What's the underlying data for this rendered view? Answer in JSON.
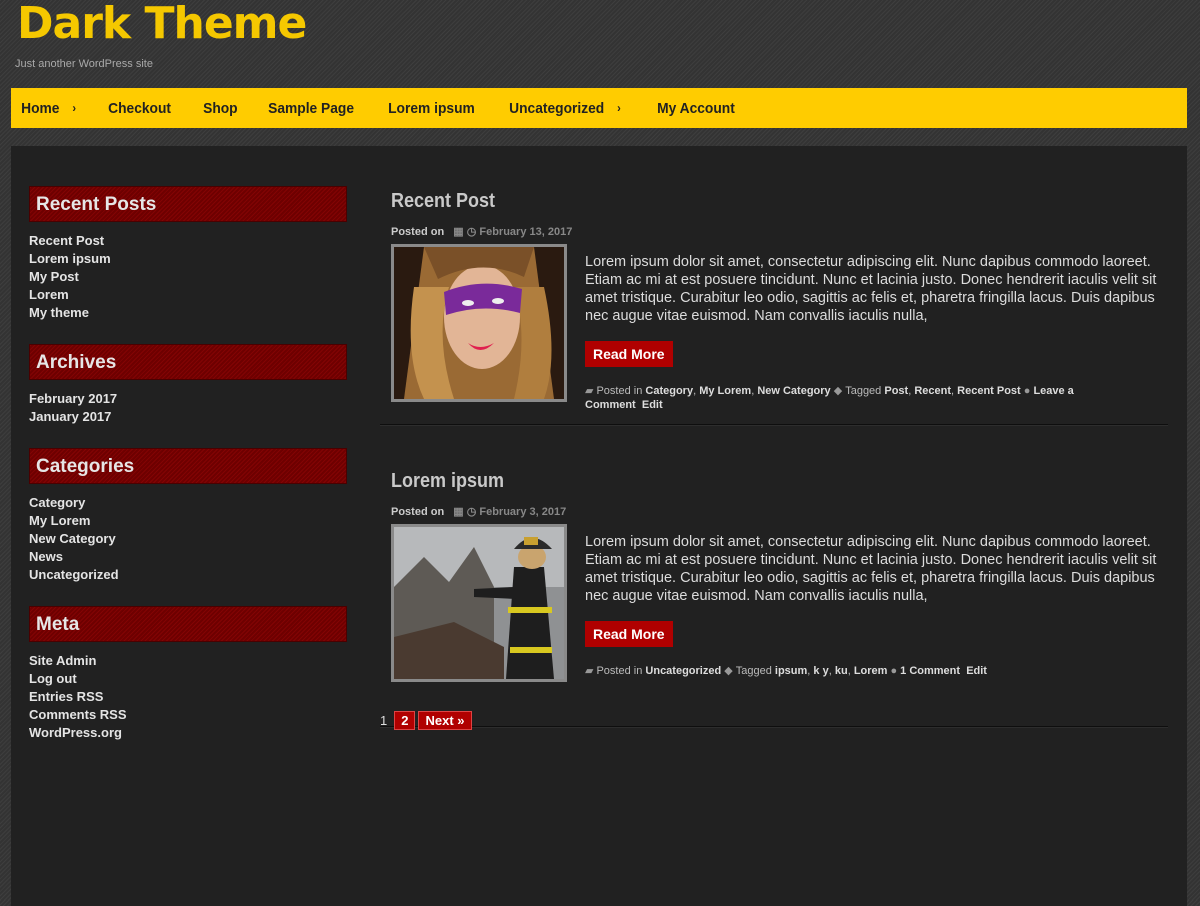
{
  "site": {
    "title": "Dark Theme",
    "tagline": "Just another WordPress site"
  },
  "nav": [
    {
      "label": "Home",
      "arrow": "›"
    },
    {
      "label": "Checkout"
    },
    {
      "label": "Shop"
    },
    {
      "label": "Sample Page"
    },
    {
      "label": "Lorem ipsum"
    },
    {
      "label": "Uncategorized",
      "arrow": "›"
    },
    {
      "label": "My Account"
    }
  ],
  "sidebar": {
    "recent_posts": {
      "title": "Recent Posts",
      "items": [
        "Recent Post",
        "Lorem ipsum",
        "My Post",
        "Lorem",
        "My theme"
      ]
    },
    "archives": {
      "title": "Archives",
      "items": [
        "February 2017",
        "January 2017"
      ]
    },
    "categories": {
      "title": "Categories",
      "items": [
        "Category",
        "My Lorem",
        "New Category",
        "News",
        "Uncategorized"
      ]
    },
    "meta": {
      "title": "Meta",
      "items": [
        "Site Admin",
        "Log out",
        "Entries RSS",
        "Comments RSS",
        "WordPress.org"
      ]
    }
  },
  "posts": [
    {
      "title": "Recent Post",
      "posted_on": "Posted on",
      "date": "February 13, 2017",
      "excerpt": "Lorem ipsum dolor sit amet, consectetur adipiscing elit. Nunc dapibus commodo laoreet. Etiam ac mi at est posuere tincidunt. Nunc et lacinia justo. Donec hendrerit iaculis velit sit amet tristique. Curabitur leo odio, sagittis ac felis et, pharetra fringilla lacus. Duis dapibus nec augue vitae euismod. Nam convallis iaculis nulla,",
      "read_more": "Read More",
      "posted_in_label": "Posted in",
      "categories": [
        "Category",
        "My Lorem",
        "New Category"
      ],
      "tagged_label": "Tagged",
      "tags": [
        "Post",
        "Recent",
        "Recent Post"
      ],
      "comments": "Leave a Comment",
      "edit": "Edit"
    },
    {
      "title": "Lorem ipsum",
      "posted_on": "Posted on",
      "date": "February 3, 2017",
      "excerpt": "Lorem ipsum dolor sit amet, consectetur adipiscing elit. Nunc dapibus commodo laoreet. Etiam ac mi at est posuere tincidunt. Nunc et lacinia justo. Donec hendrerit iaculis velit sit amet tristique. Curabitur leo odio, sagittis ac felis et, pharetra fringilla lacus. Duis dapibus nec augue vitae euismod. Nam convallis iaculis nulla,",
      "read_more": "Read More",
      "posted_in_label": "Posted in",
      "categories": [
        "Uncategorized"
      ],
      "tagged_label": "Tagged",
      "tags": [
        "ipsum",
        "k y",
        "ku",
        "Lorem"
      ],
      "comments": "1 Comment",
      "edit": "Edit"
    }
  ],
  "pagination": {
    "current": "1",
    "page2": "2",
    "next": "Next »"
  },
  "icons": {
    "calendar": "calendar-icon",
    "clock": "clock-icon",
    "folder": "folder-icon",
    "tag": "tag-icon",
    "comment": "comment-icon"
  },
  "colors": {
    "accent": "#ffcc00",
    "widget_title_bg": "#7a0000",
    "button": "#b00000"
  }
}
